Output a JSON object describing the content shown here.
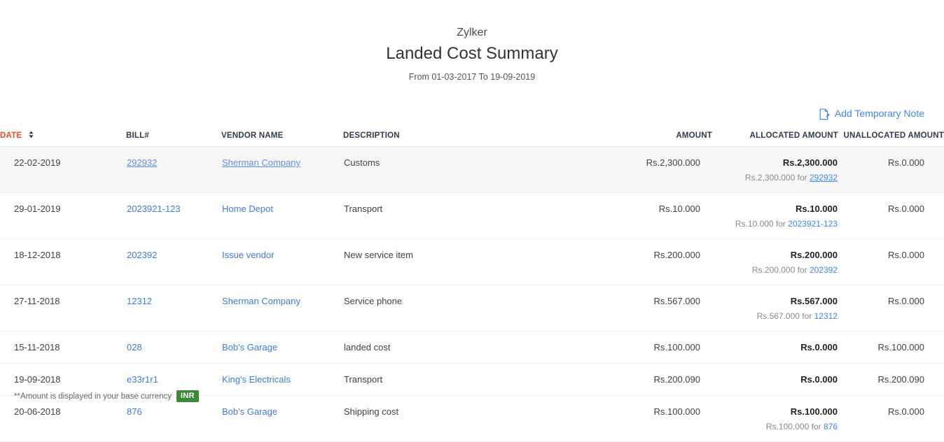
{
  "report": {
    "org_name": "Zylker",
    "title": "Landed Cost Summary",
    "date_range": "From 01-03-2017 To 19-09-2019"
  },
  "actions": {
    "add_note_label": "Add Temporary Note",
    "add_note_icon": "edit-note-icon"
  },
  "table": {
    "columns": [
      {
        "key": "date",
        "label": "DATE",
        "sorted": true,
        "sort_icon": "sort-arrow-icon",
        "color": "#ef4a2a"
      },
      {
        "key": "bill",
        "label": "BILL#"
      },
      {
        "key": "vendor",
        "label": "VENDOR NAME"
      },
      {
        "key": "description",
        "label": "DESCRIPTION"
      },
      {
        "key": "amount",
        "label": "AMOUNT"
      },
      {
        "key": "allocated",
        "label": "ALLOCATED AMOUNT"
      },
      {
        "key": "unallocated",
        "label": "UNALLOCATED AMOUNT"
      }
    ],
    "rows": [
      {
        "date": "22-02-2019",
        "bill": "292932",
        "vendor": "Sherman Company",
        "description": "Customs",
        "amount": "Rs.2,300.000",
        "allocated": "Rs.2,300.000",
        "allocated_detail_prefix": "Rs.2,300.000 for ",
        "allocated_detail_bill": "292932",
        "unallocated": "Rs.0.000",
        "hovered": true
      },
      {
        "date": "29-01-2019",
        "bill": "2023921-123",
        "vendor": "Home Depot",
        "description": "Transport",
        "amount": "Rs.10.000",
        "allocated": "Rs.10.000",
        "allocated_detail_prefix": "Rs.10.000 for ",
        "allocated_detail_bill": "2023921-123",
        "unallocated": "Rs.0.000",
        "hovered": false
      },
      {
        "date": "18-12-2018",
        "bill": "202392",
        "vendor": "Issue vendor",
        "description": "New service item",
        "amount": "Rs.200.000",
        "allocated": "Rs.200.000",
        "allocated_detail_prefix": "Rs.200.000 for ",
        "allocated_detail_bill": "202392",
        "unallocated": "Rs.0.000",
        "hovered": false
      },
      {
        "date": "27-11-2018",
        "bill": "12312",
        "vendor": "Sherman Company",
        "description": "Service phone",
        "amount": "Rs.567.000",
        "allocated": "Rs.567.000",
        "allocated_detail_prefix": "Rs.567.000 for ",
        "allocated_detail_bill": "12312",
        "unallocated": "Rs.0.000",
        "hovered": false
      },
      {
        "date": "15-11-2018",
        "bill": "028",
        "vendor": "Bob's Garage",
        "description": "landed cost",
        "amount": "Rs.100.000",
        "allocated": "Rs.0.000",
        "allocated_detail_prefix": "",
        "allocated_detail_bill": "",
        "unallocated": "Rs.100.000",
        "hovered": false
      },
      {
        "date": "19-09-2018",
        "bill": "e33r1r1",
        "vendor": "King's Electricals",
        "description": "Transport",
        "amount": "Rs.200.090",
        "allocated": "Rs.0.000",
        "allocated_detail_prefix": "",
        "allocated_detail_bill": "",
        "unallocated": "Rs.200.090",
        "hovered": false
      },
      {
        "date": "20-06-2018",
        "bill": "876",
        "vendor": "Bob's Garage",
        "description": "Shipping cost",
        "amount": "Rs.100.000",
        "allocated": "Rs.100.000",
        "allocated_detail_prefix": "Rs.100.000 for ",
        "allocated_detail_bill": "876",
        "unallocated": "Rs.0.000",
        "hovered": false
      }
    ]
  },
  "footer": {
    "note": "**Amount is displayed in your base currency",
    "currency_badge": "INR",
    "currency_badge_color": "#3c8a35"
  }
}
